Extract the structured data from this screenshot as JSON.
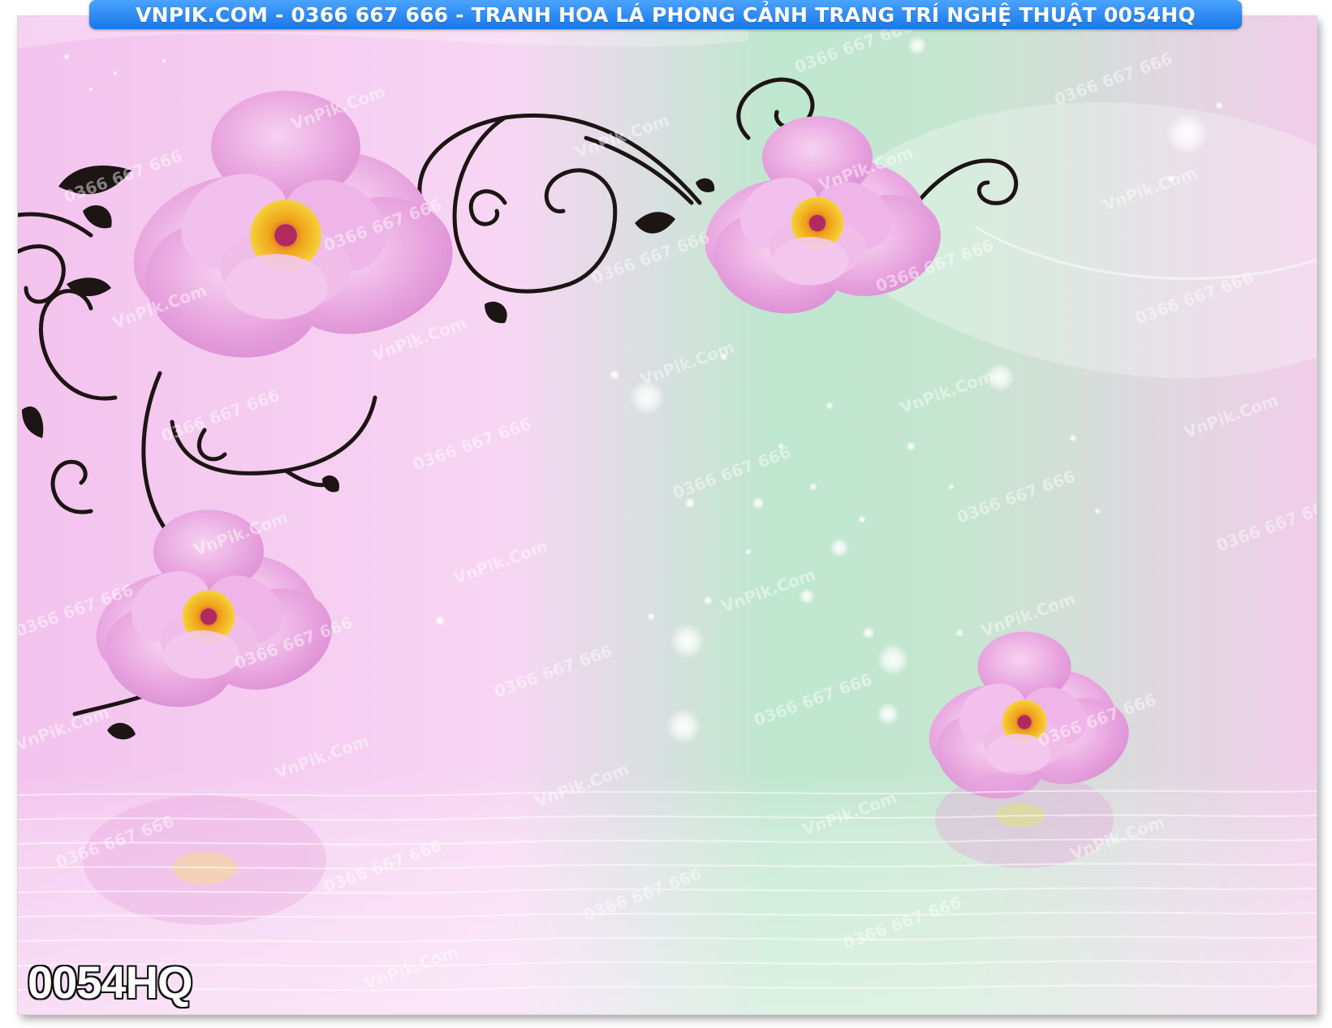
{
  "banner": {
    "text": "VNPIK.COM - 0366 667 666 - TRANH HOA LÁ PHONG CẢNH TRANG TRÍ NGHỆ THUẬT 0054HQ"
  },
  "product_code": "0054HQ",
  "watermarks": {
    "site": "VnPik.Com",
    "phone": "0366 667 666"
  },
  "colors": {
    "banner_blue": "#1e7ff0",
    "background_pink": "#f5c9ef",
    "background_green": "#b9e6c9",
    "petal_pink": "#e9a6df",
    "flower_center": "#f2c51a",
    "vine": "#1d1414"
  }
}
